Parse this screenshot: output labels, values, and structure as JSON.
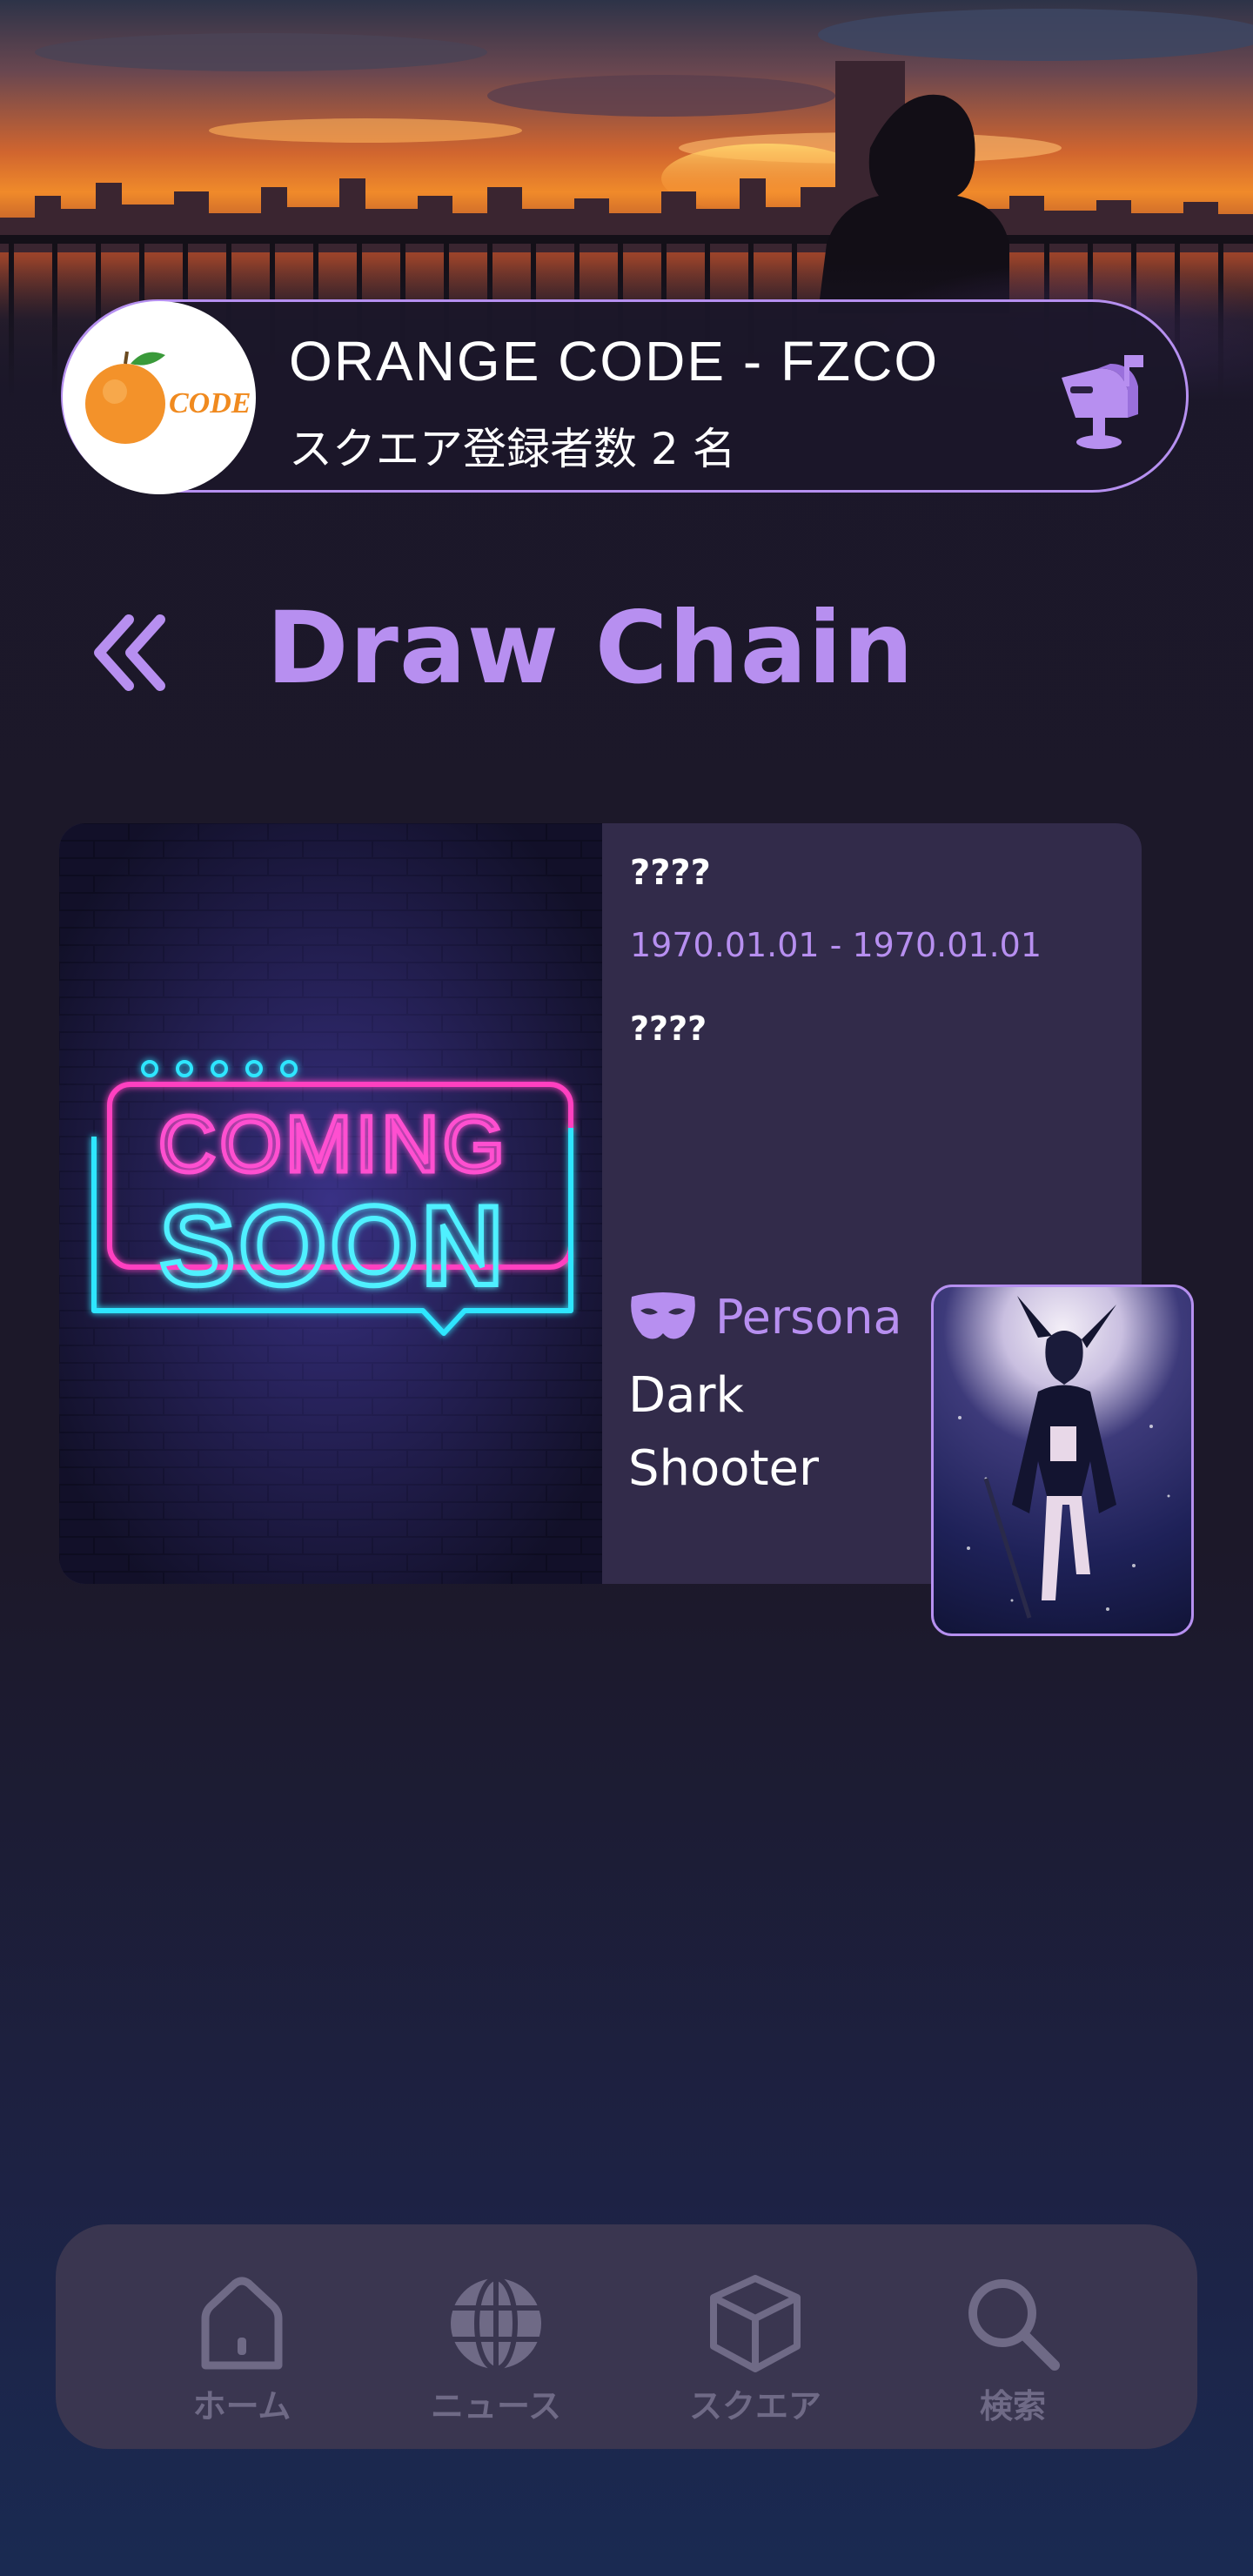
{
  "header": {
    "company_name": "ORANGE CODE - FZCO",
    "registrant_count": "スクエア登録者数 2 名",
    "logo_text": "CODE"
  },
  "page": {
    "title": "Draw Chain"
  },
  "event_card": {
    "image_text_top": "COMING",
    "image_text_bottom": "SOON",
    "title": "????",
    "dates": "1970.01.01 - 1970.01.01",
    "description": "????",
    "persona_label": "Persona",
    "persona_name": "Dark Shooter"
  },
  "bottom_nav": {
    "items": [
      {
        "label": "ホーム",
        "icon": "home-icon"
      },
      {
        "label": "ニュース",
        "icon": "globe-icon"
      },
      {
        "label": "スクエア",
        "icon": "cube-icon"
      },
      {
        "label": "検索",
        "icon": "search-icon"
      }
    ]
  },
  "colors": {
    "accent": "#b78ff0",
    "background": "#1b1729",
    "card": "#322b4a",
    "nav_background": "#3a3650",
    "nav_label": "#6f6a86"
  }
}
